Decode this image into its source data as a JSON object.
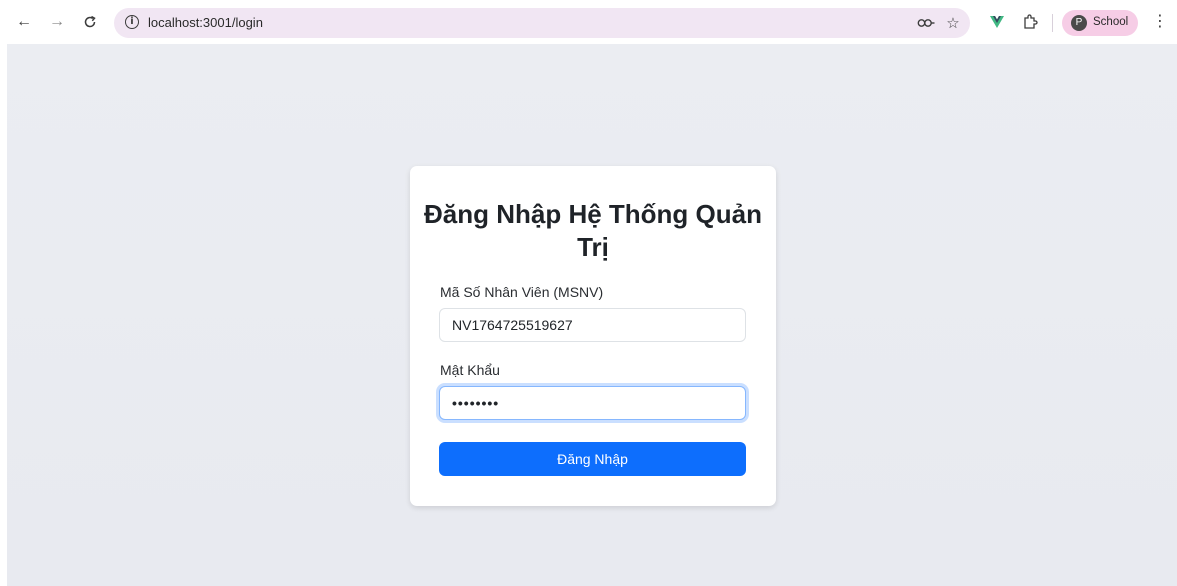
{
  "browser": {
    "url": "localhost:3001/login",
    "profile_initial": "P",
    "profile_name": "School"
  },
  "login": {
    "title": "Đăng Nhập Hệ Thống Quản Trị",
    "employee_id_label": "Mã Số Nhân Viên (MSNV)",
    "employee_id_value": "NV1764725519627",
    "password_label": "Mật Khẩu",
    "password_masked": "••••••••",
    "submit_label": "Đăng Nhập"
  },
  "colors": {
    "primary_button": "#0d6efd",
    "page_background": "#ebedf2",
    "omnibox_background": "#f1e6f3",
    "profile_chip": "#f6cde6",
    "focus_ring": "#86b7fe"
  },
  "icons": {
    "back": "back-arrow-icon",
    "forward": "forward-arrow-icon",
    "reload": "reload-icon",
    "site_info": "info-icon",
    "password_key": "key-icon",
    "bookmark": "star-icon",
    "vue_devtools": "vue-icon",
    "extensions": "puzzle-icon",
    "menu": "kebab-menu-icon"
  }
}
